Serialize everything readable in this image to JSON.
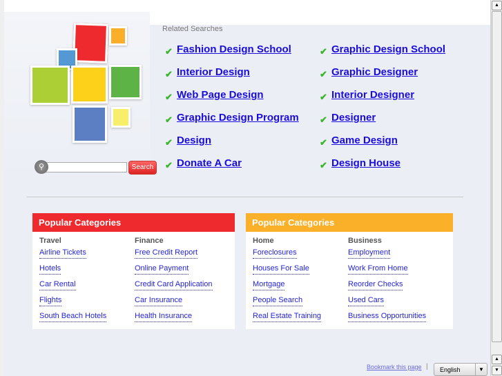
{
  "related": {
    "title": "Related Searches",
    "left": [
      "Fashion Design School",
      "Interior Design",
      "Web Page Design",
      "Graphic Design Program",
      "Design",
      "Donate A Car"
    ],
    "right": [
      "Graphic Design School",
      "Graphic Designer",
      "Interior Designer",
      "Designer",
      "Game Design",
      "Design House"
    ]
  },
  "search": {
    "button": "Search",
    "value": ""
  },
  "categories": [
    {
      "title": "Popular Categories",
      "color": "#ee2a2e",
      "cols": [
        {
          "heading": "Travel",
          "links": [
            "Airline Tickets",
            "Hotels",
            "Car Rental",
            "Flights",
            "South Beach Hotels"
          ]
        },
        {
          "heading": "Finance",
          "links": [
            "Free Credit Report",
            "Online Payment",
            "Credit Card Application",
            "Car Insurance",
            "Health Insurance"
          ]
        }
      ]
    },
    {
      "title": "Popular Categories",
      "color": "#fbb02a",
      "cols": [
        {
          "heading": "Home",
          "links": [
            "Foreclosures",
            "Houses For Sale",
            "Mortgage",
            "People Search",
            "Real Estate Training"
          ]
        },
        {
          "heading": "Business",
          "links": [
            "Employment",
            "Work From Home",
            "Reorder Checks",
            "Used Cars",
            "Business Opportunities"
          ]
        }
      ]
    }
  ],
  "footer": {
    "bookmark": "Bookmark this page",
    "pipe": "|",
    "language": "English"
  }
}
